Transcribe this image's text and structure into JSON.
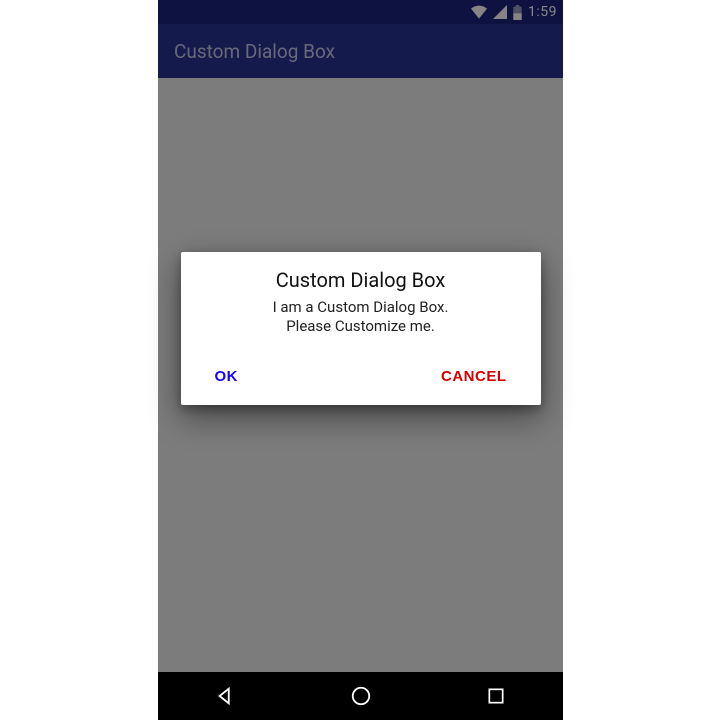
{
  "status": {
    "clock": "1:59",
    "icons": {
      "wifi": "wifi-icon",
      "signal": "cellular-signal-icon",
      "battery": "battery-icon"
    }
  },
  "appbar": {
    "title": "Custom Dialog Box"
  },
  "dialog": {
    "title": "Custom Dialog Box",
    "message": "I am a Custom Dialog Box.\nPlease Customize me.",
    "ok_label": "OK",
    "cancel_label": "CANCEL"
  },
  "navbar": {
    "back": "back-icon",
    "home": "home-icon",
    "recents": "recents-icon"
  },
  "colors": {
    "primary": "#283593",
    "primary_dark": "#1a237e",
    "scrim": "rgba(0,0,0,0.48)",
    "ok": "#1600ff",
    "cancel": "#d50000"
  }
}
